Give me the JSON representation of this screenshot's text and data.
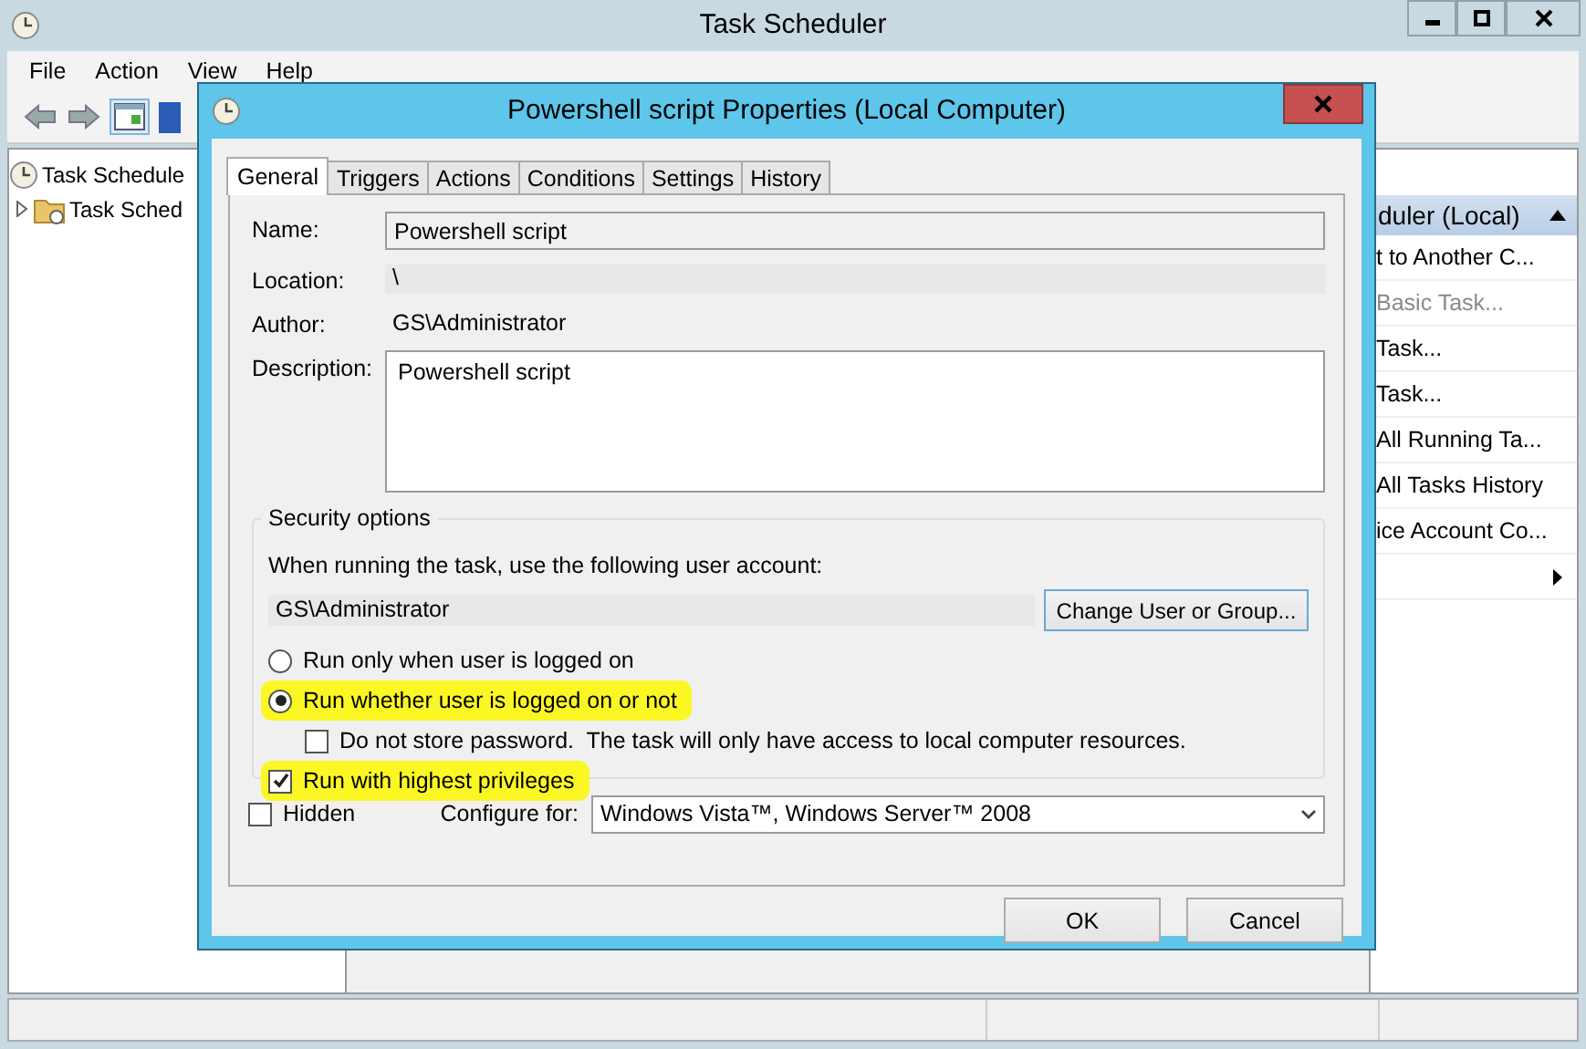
{
  "window": {
    "title": "Task Scheduler"
  },
  "menu": [
    "File",
    "Action",
    "View",
    "Help"
  ],
  "tree": [
    {
      "label": "Task Schedule",
      "children": [
        {
          "label": "Task Sched",
          "expanded": false
        }
      ]
    }
  ],
  "actions_panel": {
    "header": "duler (Local)",
    "items": [
      {
        "kind": "action",
        "label": "t to Another C...",
        "disabled": false
      },
      {
        "kind": "action",
        "label": "Basic Task...",
        "disabled": true
      },
      {
        "kind": "action",
        "label": "Task...",
        "disabled": false
      },
      {
        "kind": "action",
        "label": "Task...",
        "disabled": false
      },
      {
        "kind": "action",
        "label": "All Running Ta...",
        "disabled": false
      },
      {
        "kind": "action",
        "label": "All Tasks History",
        "disabled": false
      },
      {
        "kind": "action",
        "label": "ice Account Co...",
        "disabled": false
      },
      {
        "kind": "submenu"
      }
    ]
  },
  "dialog": {
    "title": "Powershell script Properties (Local Computer)",
    "tabs": [
      {
        "label": "General",
        "selected": true
      },
      {
        "label": "Triggers",
        "selected": false
      },
      {
        "label": "Actions",
        "selected": false
      },
      {
        "label": "Conditions",
        "selected": false
      },
      {
        "label": "Settings",
        "selected": false
      },
      {
        "label": "History",
        "selected": false
      }
    ],
    "fields": [
      {
        "kind": "readonly",
        "label": "Name:",
        "value": "Powershell script"
      },
      {
        "kind": "plain",
        "label": "Location:",
        "value": "\\"
      },
      {
        "kind": "text",
        "label": "Author:",
        "value": "GS\\Administrator"
      },
      {
        "kind": "multiline",
        "label": "Description:",
        "value": "Powershell script"
      }
    ],
    "security": {
      "legend": "Security options",
      "prompt": "When running the task, use the following user account:",
      "account": "GS\\Administrator",
      "change_button": "Change User or Group...",
      "options": [
        {
          "kind": "radio",
          "label": "Run only when user is logged on",
          "selected": false,
          "highlighted": false
        },
        {
          "kind": "radio",
          "label": "Run whether user is logged on or not",
          "selected": true,
          "highlighted": true
        },
        {
          "kind": "subcheck",
          "label": "Do not store password.  The task will only have access to local computer resources.",
          "checked": false,
          "highlighted": false
        },
        {
          "kind": "check",
          "label": "Run with highest privileges",
          "checked": true,
          "highlighted": true
        }
      ]
    },
    "hidden": {
      "label": "Hidden",
      "checked": false
    },
    "configure": {
      "label": "Configure for:",
      "value": "Windows Vista™, Windows Server™ 2008"
    },
    "buttons": [
      "OK",
      "Cancel"
    ]
  }
}
